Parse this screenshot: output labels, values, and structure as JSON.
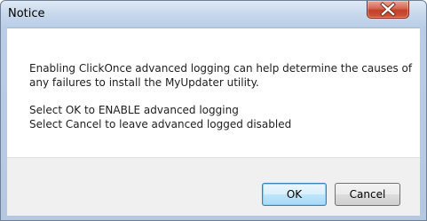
{
  "dialog": {
    "title": "Notice",
    "close_icon": "close-x-icon",
    "message_line_1": "Enabling ClickOnce advanced logging can help determine the causes of",
    "message_line_2": "any failures to install the MyUpdater utility.",
    "message_line_3": "Select OK to ENABLE advanced logging",
    "message_line_4": "Select Cancel to leave advanced logged disabled",
    "ok_label": "OK",
    "cancel_label": "Cancel"
  },
  "colors": {
    "frame": "#b9cde6",
    "close_button": "#c2402a",
    "ok_border": "#3c7fb1"
  }
}
